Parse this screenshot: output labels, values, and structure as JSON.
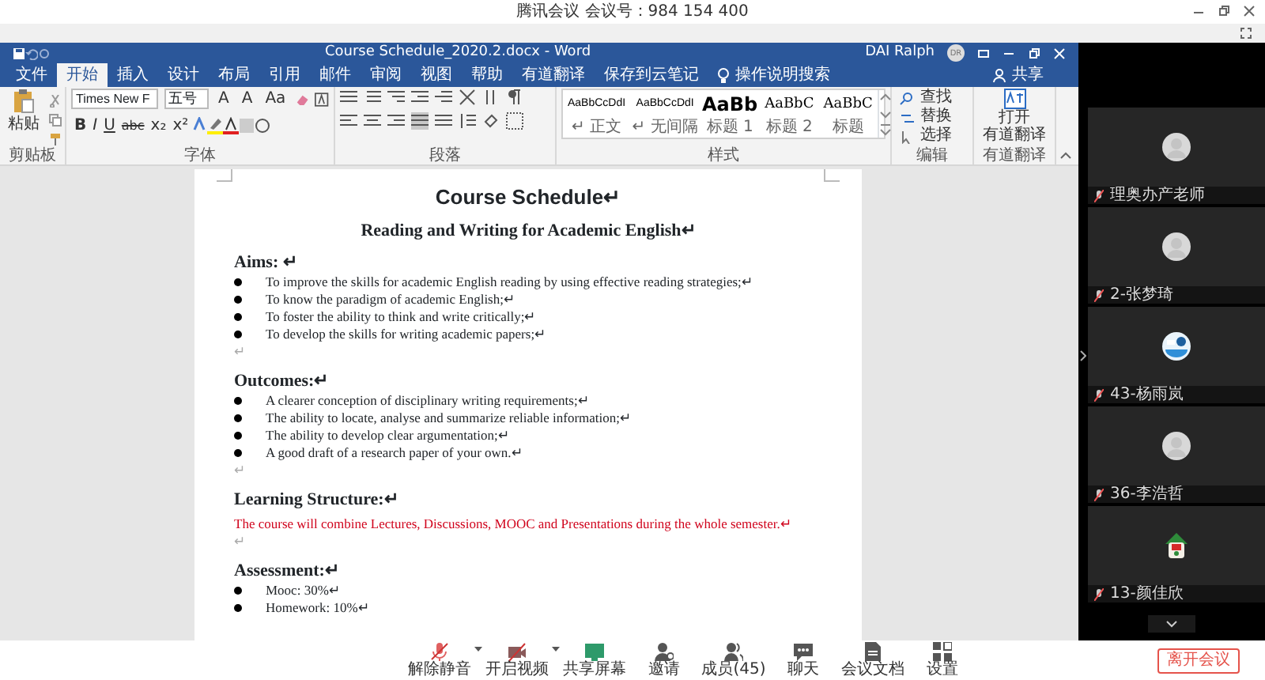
{
  "meeting": {
    "title": "腾讯会议 会议号：984 154 400"
  },
  "word": {
    "title": "Course Schedule_2020.2.docx - Word",
    "user": "DAI Ralph",
    "avatar": "DR",
    "search": "操作说明搜索",
    "share": "共享",
    "tabs": [
      {
        "label": "文件",
        "selected": false
      },
      {
        "label": "开始",
        "selected": true
      },
      {
        "label": "插入",
        "selected": false
      },
      {
        "label": "设计",
        "selected": false
      },
      {
        "label": "布局",
        "selected": false
      },
      {
        "label": "引用",
        "selected": false
      },
      {
        "label": "邮件",
        "selected": false
      },
      {
        "label": "审阅",
        "selected": false
      },
      {
        "label": "视图",
        "selected": false
      },
      {
        "label": "帮助",
        "selected": false
      },
      {
        "label": "有道翻译",
        "selected": false
      },
      {
        "label": "保存到云笔记",
        "selected": false
      }
    ],
    "ribbon": {
      "clipboard": {
        "paste": "粘贴",
        "label": "剪贴板"
      },
      "font": {
        "name": "Times New F",
        "size": "五号",
        "row1": [
          "A",
          "A",
          "Aa"
        ],
        "row2": [
          "B",
          "I",
          "U",
          "abc",
          "x₂",
          "x²"
        ],
        "label": "字体"
      },
      "paragraph": {
        "label": "段落"
      },
      "styles": {
        "label": "样式",
        "items": [
          {
            "preview": "AaBbCcDdI",
            "name": "↵ 正文",
            "kind": "body"
          },
          {
            "preview": "AaBbCcDdI",
            "name": "↵ 无间隔",
            "kind": "body"
          },
          {
            "preview": "AaBb",
            "name": "标题 1",
            "kind": "heading1"
          },
          {
            "preview": "AaBbC",
            "name": "标题 2",
            "kind": "heading2"
          },
          {
            "preview": "AaBbC",
            "name": "标题",
            "kind": "heading2"
          }
        ]
      },
      "editing": {
        "label": "编辑",
        "items": [
          "查找",
          "替换",
          "选择"
        ]
      },
      "translate": {
        "label": "有道翻译",
        "button": [
          "打开",
          "有道翻译"
        ]
      }
    }
  },
  "document": {
    "title": "Course Schedule↵",
    "subtitle": "Reading and Writing for Academic English↵",
    "blocks": [
      {
        "kind": "heading",
        "text": "Aims:  ↵"
      },
      {
        "kind": "bullet",
        "text": "To improve the skills for academic English reading by using effective reading strategies;↵"
      },
      {
        "kind": "bullet",
        "text": "To know the paradigm of academic English;↵"
      },
      {
        "kind": "bullet",
        "text": "To foster the ability to think and write critically;↵"
      },
      {
        "kind": "bullet",
        "text": "To develop the skills for writing academic papers;↵"
      },
      {
        "kind": "blank",
        "text": "↵"
      },
      {
        "kind": "heading",
        "text": "Outcomes:↵"
      },
      {
        "kind": "bullet",
        "text": "A clearer conception of disciplinary writing requirements;↵"
      },
      {
        "kind": "bullet",
        "text": "The ability to locate, analyse and summarize reliable information;↵"
      },
      {
        "kind": "bullet",
        "text": "The ability to develop clear argumentation;↵"
      },
      {
        "kind": "bullet",
        "text": "A good draft of a research paper of your own.↵"
      },
      {
        "kind": "blank",
        "text": "↵"
      },
      {
        "kind": "heading",
        "text": "Learning Structure:↵"
      },
      {
        "kind": "emphasis",
        "text": "The course will combine Lectures, Discussions, MOOC and Presentations during the whole semester.↵"
      },
      {
        "kind": "blank",
        "text": "↵"
      },
      {
        "kind": "heading",
        "text": "Assessment:↵"
      },
      {
        "kind": "bullet",
        "text": "Mooc: 30%↵"
      },
      {
        "kind": "bullet",
        "text": "Homework: 10%↵"
      }
    ]
  },
  "participants": [
    {
      "name": "理奥办产老师",
      "kind": "default"
    },
    {
      "name": "2-张梦琦",
      "kind": "default"
    },
    {
      "name": "43-杨雨岚",
      "kind": "globe"
    },
    {
      "name": "36-李浩哲",
      "kind": "default"
    },
    {
      "name": "13-颜佳欣",
      "kind": "cartoon"
    }
  ],
  "toolbar": {
    "items": [
      {
        "label": "解除静音",
        "kind": "mic-off",
        "menu": true
      },
      {
        "label": "开启视频",
        "kind": "camera-off",
        "menu": true
      },
      {
        "label": "共享屏幕",
        "kind": "share",
        "menu": false
      },
      {
        "label": "邀请",
        "kind": "invite",
        "menu": false
      },
      {
        "label": "成员(45)",
        "kind": "members",
        "menu": false
      },
      {
        "label": "聊天",
        "kind": "chat",
        "menu": false
      },
      {
        "label": "会议文档",
        "kind": "docs",
        "menu": false
      },
      {
        "label": "设置",
        "kind": "settings",
        "menu": false
      }
    ],
    "leave": "离开会议"
  }
}
